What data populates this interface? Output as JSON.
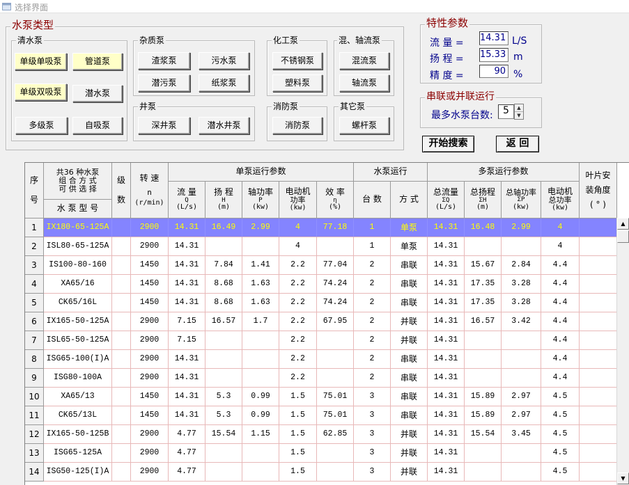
{
  "window": {
    "title": "选择界面"
  },
  "pump_type": {
    "legend": "水泵类型",
    "groups": {
      "clean": {
        "legend": "清水泵",
        "buttons": [
          "单级单吸泵",
          "管道泵",
          "单级双吸泵",
          "潜水泵",
          "多级泵",
          "自吸泵"
        ]
      },
      "misc": {
        "legend": "杂质泵",
        "buttons": [
          "渣浆泵",
          "污水泵",
          "潜污泵",
          "纸浆泵"
        ]
      },
      "well": {
        "legend": "井泵",
        "buttons": [
          "深井泵",
          "潜水井泵"
        ]
      },
      "chem": {
        "legend": "化工泵",
        "buttons": [
          "不锈钢泵",
          "塑料泵"
        ]
      },
      "fire": {
        "legend": "消防泵",
        "buttons": [
          "消防泵"
        ]
      },
      "mixed": {
        "legend": "混、轴流泵",
        "buttons": [
          "混流泵",
          "轴流泵"
        ]
      },
      "other": {
        "legend": "其它泵",
        "buttons": [
          "螺杆泵"
        ]
      }
    }
  },
  "params": {
    "legend": "特性参数",
    "flow": {
      "label": "流  量 =",
      "value": "14.31",
      "unit": "L/S"
    },
    "head": {
      "label": "扬  程 =",
      "value": "15.33",
      "unit": "m"
    },
    "precision": {
      "label": "精  度 =",
      "value": "90",
      "unit": "%"
    }
  },
  "series": {
    "legend": "串联或并联运行",
    "label": "最多水泵台数:",
    "value": "5"
  },
  "actions": {
    "search": "开始搜索",
    "back": "返  回"
  },
  "colors": {
    "selected_bg": "#8484ff",
    "selected_fg": "#ffff00",
    "legend": "#8b0000",
    "label": "#00008b",
    "highlight_button": "#ffffc8"
  },
  "grid": {
    "headers": {
      "seq": [
        "序",
        "号"
      ],
      "combo": [
        "共36 种水泵",
        "组 合 方 式",
        "可 供 选 择"
      ],
      "model": "水 泵 型 号",
      "stage": [
        "级",
        "数"
      ],
      "speed": [
        "转  速",
        "n",
        "(r/min)"
      ],
      "single_group": "单泵运行参数",
      "flow": [
        "流  量",
        "Q",
        "(L/s)"
      ],
      "head": [
        "扬  程",
        "H",
        "(m)"
      ],
      "shaft": [
        "轴功率",
        "P",
        "(kw)"
      ],
      "motor": [
        "电动机",
        "功率",
        "(kw)"
      ],
      "eff": [
        "效  率",
        "η",
        "(%)"
      ],
      "run_group": "水泵运行",
      "count": "台  数",
      "mode": "方  式",
      "multi_group": "多泵运行参数",
      "tflow": [
        "总流量",
        "ΣQ",
        "(L/s)"
      ],
      "thead": [
        "总扬程",
        "ΣH",
        "(m)"
      ],
      "tshaft": [
        "总轴功率",
        "ΣP",
        "(kw)"
      ],
      "tmotor": [
        "电动机",
        "总功率",
        "(kw)"
      ],
      "blade": [
        "叶片安",
        "装角度",
        "( ° )"
      ]
    },
    "rows": [
      {
        "no": "1",
        "model": "IX180-65-125A",
        "stage": "",
        "speed": "2900",
        "q": "14.31",
        "h": "16.49",
        "p": "2.99",
        "m": "4",
        "e": "77.18",
        "n": "1",
        "mode": "单泵",
        "tq": "14.31",
        "th": "16.48",
        "tp": "2.99",
        "tm": "4",
        "blade": "",
        "selected": true
      },
      {
        "no": "2",
        "model": "ISL80-65-125A",
        "stage": "",
        "speed": "2900",
        "q": "14.31",
        "h": "",
        "p": "",
        "m": "4",
        "e": "",
        "n": "1",
        "mode": "单泵",
        "tq": "14.31",
        "th": "",
        "tp": "",
        "tm": "4",
        "blade": ""
      },
      {
        "no": "3",
        "model": "IS100-80-160",
        "stage": "",
        "speed": "1450",
        "q": "14.31",
        "h": "7.84",
        "p": "1.41",
        "m": "2.2",
        "e": "77.04",
        "n": "2",
        "mode": "串联",
        "tq": "14.31",
        "th": "15.67",
        "tp": "2.84",
        "tm": "4.4",
        "blade": ""
      },
      {
        "no": "4",
        "model": "XA65/16",
        "stage": "",
        "speed": "1450",
        "q": "14.31",
        "h": "8.68",
        "p": "1.63",
        "m": "2.2",
        "e": "74.24",
        "n": "2",
        "mode": "串联",
        "tq": "14.31",
        "th": "17.35",
        "tp": "3.28",
        "tm": "4.4",
        "blade": ""
      },
      {
        "no": "5",
        "model": "CK65/16L",
        "stage": "",
        "speed": "1450",
        "q": "14.31",
        "h": "8.68",
        "p": "1.63",
        "m": "2.2",
        "e": "74.24",
        "n": "2",
        "mode": "串联",
        "tq": "14.31",
        "th": "17.35",
        "tp": "3.28",
        "tm": "4.4",
        "blade": ""
      },
      {
        "no": "6",
        "model": "IX165-50-125A",
        "stage": "",
        "speed": "2900",
        "q": "7.15",
        "h": "16.57",
        "p": "1.7",
        "m": "2.2",
        "e": "67.95",
        "n": "2",
        "mode": "并联",
        "tq": "14.31",
        "th": "16.57",
        "tp": "3.42",
        "tm": "4.4",
        "blade": ""
      },
      {
        "no": "7",
        "model": "ISL65-50-125A",
        "stage": "",
        "speed": "2900",
        "q": "7.15",
        "h": "",
        "p": "",
        "m": "2.2",
        "e": "",
        "n": "2",
        "mode": "并联",
        "tq": "14.31",
        "th": "",
        "tp": "",
        "tm": "4.4",
        "blade": ""
      },
      {
        "no": "8",
        "model": "ISG65-100(I)A",
        "stage": "",
        "speed": "2900",
        "q": "14.31",
        "h": "",
        "p": "",
        "m": "2.2",
        "e": "",
        "n": "2",
        "mode": "串联",
        "tq": "14.31",
        "th": "",
        "tp": "",
        "tm": "4.4",
        "blade": ""
      },
      {
        "no": "9",
        "model": "ISG80-100A",
        "stage": "",
        "speed": "2900",
        "q": "14.31",
        "h": "",
        "p": "",
        "m": "2.2",
        "e": "",
        "n": "2",
        "mode": "串联",
        "tq": "14.31",
        "th": "",
        "tp": "",
        "tm": "4.4",
        "blade": ""
      },
      {
        "no": "10",
        "model": "XA65/13",
        "stage": "",
        "speed": "1450",
        "q": "14.31",
        "h": "5.3",
        "p": "0.99",
        "m": "1.5",
        "e": "75.01",
        "n": "3",
        "mode": "串联",
        "tq": "14.31",
        "th": "15.89",
        "tp": "2.97",
        "tm": "4.5",
        "blade": ""
      },
      {
        "no": "11",
        "model": "CK65/13L",
        "stage": "",
        "speed": "1450",
        "q": "14.31",
        "h": "5.3",
        "p": "0.99",
        "m": "1.5",
        "e": "75.01",
        "n": "3",
        "mode": "串联",
        "tq": "14.31",
        "th": "15.89",
        "tp": "2.97",
        "tm": "4.5",
        "blade": ""
      },
      {
        "no": "12",
        "model": "IX165-50-125B",
        "stage": "",
        "speed": "2900",
        "q": "4.77",
        "h": "15.54",
        "p": "1.15",
        "m": "1.5",
        "e": "62.85",
        "n": "3",
        "mode": "并联",
        "tq": "14.31",
        "th": "15.54",
        "tp": "3.45",
        "tm": "4.5",
        "blade": ""
      },
      {
        "no": "13",
        "model": "ISG65-125A",
        "stage": "",
        "speed": "2900",
        "q": "4.77",
        "h": "",
        "p": "",
        "m": "1.5",
        "e": "",
        "n": "3",
        "mode": "并联",
        "tq": "14.31",
        "th": "",
        "tp": "",
        "tm": "4.5",
        "blade": ""
      },
      {
        "no": "14",
        "model": "ISG50-125(I)A",
        "stage": "",
        "speed": "2900",
        "q": "4.77",
        "h": "",
        "p": "",
        "m": "1.5",
        "e": "",
        "n": "3",
        "mode": "并联",
        "tq": "14.31",
        "th": "",
        "tp": "",
        "tm": "4.5",
        "blade": ""
      }
    ]
  }
}
